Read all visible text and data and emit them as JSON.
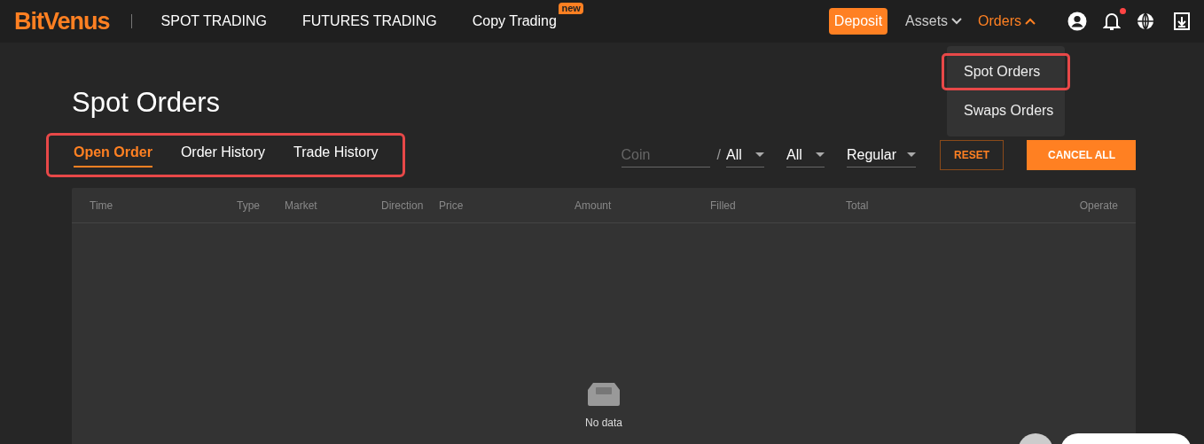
{
  "header": {
    "logo": "BitVenus",
    "nav": [
      {
        "label": "SPOT TRADING"
      },
      {
        "label": "FUTURES TRADING"
      },
      {
        "label": "Copy Trading",
        "badge": "new"
      }
    ],
    "deposit": "Deposit",
    "menus": [
      {
        "label": "Assets",
        "expanded": false
      },
      {
        "label": "Orders",
        "expanded": true
      }
    ],
    "notification_dot": true
  },
  "orders_menu": [
    {
      "label": "Spot Orders",
      "highlighted": true
    },
    {
      "label": "Swaps Orders",
      "highlighted": false
    }
  ],
  "page_title": "Spot Orders",
  "tabs_highlighted": true,
  "tabs": [
    {
      "label": "Open Order",
      "selected": true
    },
    {
      "label": "Order History",
      "selected": false
    },
    {
      "label": "Trade History",
      "selected": false
    }
  ],
  "filters": {
    "coin_placeholder": "Coin",
    "separator": "/",
    "selects": [
      "All",
      "All",
      "Regular"
    ],
    "reset": "RESET",
    "cancel_all": "CANCEL ALL"
  },
  "table": {
    "columns": [
      "Time",
      "Type",
      "Market",
      "Direction",
      "Price",
      "Amount",
      "Filled",
      "Total",
      "Operate"
    ],
    "empty_text": "No data"
  }
}
